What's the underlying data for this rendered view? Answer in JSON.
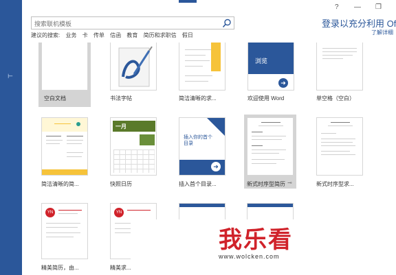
{
  "window": {
    "help": "?",
    "minimize": "—",
    "restore": "❐",
    "account": {
      "signin": "登录以充分利用 Offi",
      "learn_more": "了解详细"
    }
  },
  "left_nav": {
    "glyph": "⊢"
  },
  "search": {
    "placeholder": "搜索联机模板",
    "icon": "search-icon"
  },
  "suggested": {
    "label": "建议的搜索:",
    "items": [
      "业务",
      "卡",
      "传单",
      "信函",
      "教育",
      "简历和求职信",
      "假日"
    ]
  },
  "templates": [
    {
      "label": "空白文档"
    },
    {
      "label": "书法字帖"
    },
    {
      "label": "简洁清晰的求..."
    },
    {
      "label": "欢迎使用 Word",
      "tile_title": "浏览"
    },
    {
      "label": "单空格（空白）"
    },
    {
      "label": "简洁清晰的简..."
    },
    {
      "label": "快照日历",
      "tile_title": "一月"
    },
    {
      "label": "插入首个目录...",
      "tile_title": "插入你的首个目录"
    },
    {
      "label": "新式时序型简历",
      "pin": "⊸"
    },
    {
      "label": "新式时序型求..."
    },
    {
      "label": "精美简历，由..."
    },
    {
      "label": "精美求..."
    }
  ],
  "watermark": {
    "text": "我乐看",
    "url": "www.wolcken.com"
  },
  "colors": {
    "accent": "#2b579a",
    "watermark_red": "#d0222a",
    "selected": "#d4d4d4"
  }
}
